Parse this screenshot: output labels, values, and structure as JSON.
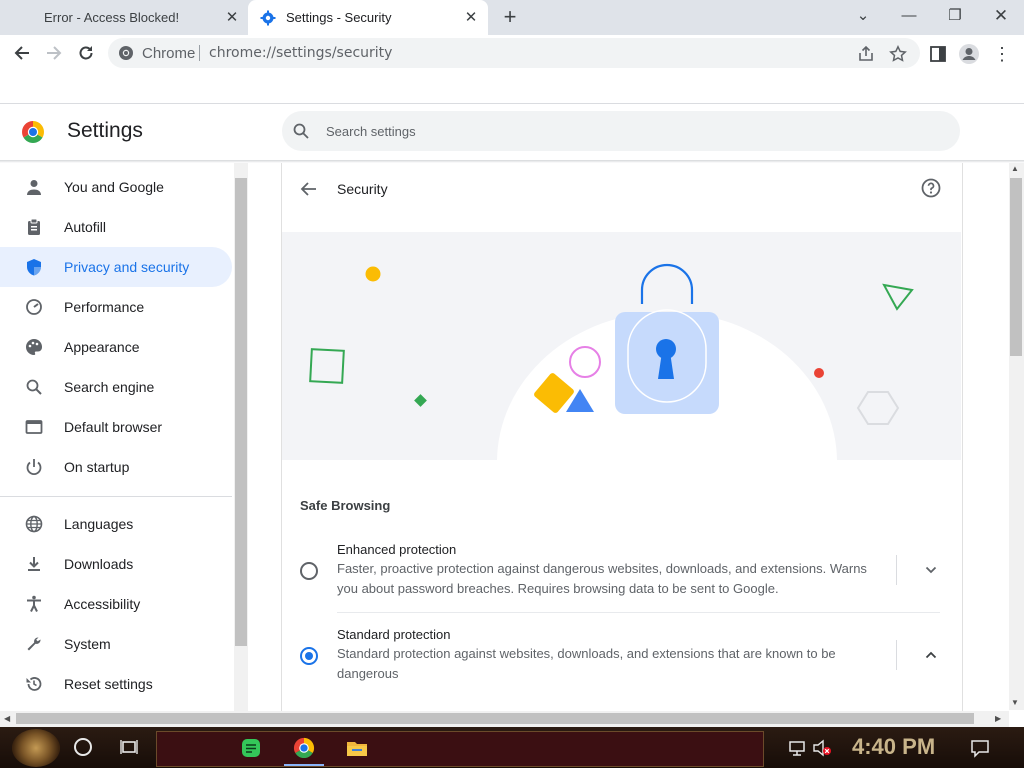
{
  "browser": {
    "tabs": [
      {
        "title": "Error - Access Blocked!",
        "active": false
      },
      {
        "title": "Settings - Security",
        "active": true
      }
    ],
    "omnibox": {
      "site_label": "Chrome",
      "url": "chrome://settings/security"
    }
  },
  "settings": {
    "title": "Settings",
    "search_placeholder": "Search settings",
    "nav": [
      {
        "label": "You and Google",
        "icon": "person-icon"
      },
      {
        "label": "Autofill",
        "icon": "clipboard-icon"
      },
      {
        "label": "Privacy and security",
        "icon": "shield-icon",
        "active": true
      },
      {
        "label": "Performance",
        "icon": "speedometer-icon"
      },
      {
        "label": "Appearance",
        "icon": "palette-icon"
      },
      {
        "label": "Search engine",
        "icon": "search-icon"
      },
      {
        "label": "Default browser",
        "icon": "browser-window-icon"
      },
      {
        "label": "On startup",
        "icon": "power-icon"
      },
      {
        "label": "Languages",
        "icon": "globe-icon"
      },
      {
        "label": "Downloads",
        "icon": "download-icon"
      },
      {
        "label": "Accessibility",
        "icon": "accessibility-icon"
      },
      {
        "label": "System",
        "icon": "wrench-icon"
      },
      {
        "label": "Reset settings",
        "icon": "reset-history-icon"
      }
    ],
    "page": {
      "heading": "Security",
      "section_label": "Safe Browsing",
      "options": [
        {
          "title": "Enhanced protection",
          "description": "Faster, proactive protection against dangerous websites, downloads, and extensions. Warns you about password breaches. Requires browsing data to be sent to Google.",
          "selected": false,
          "expanded": false
        },
        {
          "title": "Standard protection",
          "description": "Standard protection against websites, downloads, and extensions that are known to be dangerous",
          "selected": true,
          "expanded": true
        }
      ]
    }
  },
  "taskbar": {
    "clock": "4:40 PM"
  },
  "colors": {
    "accent": "#1a73e8",
    "active_nav_bg": "#e8f0fe",
    "taskbar": "#1e120b"
  }
}
